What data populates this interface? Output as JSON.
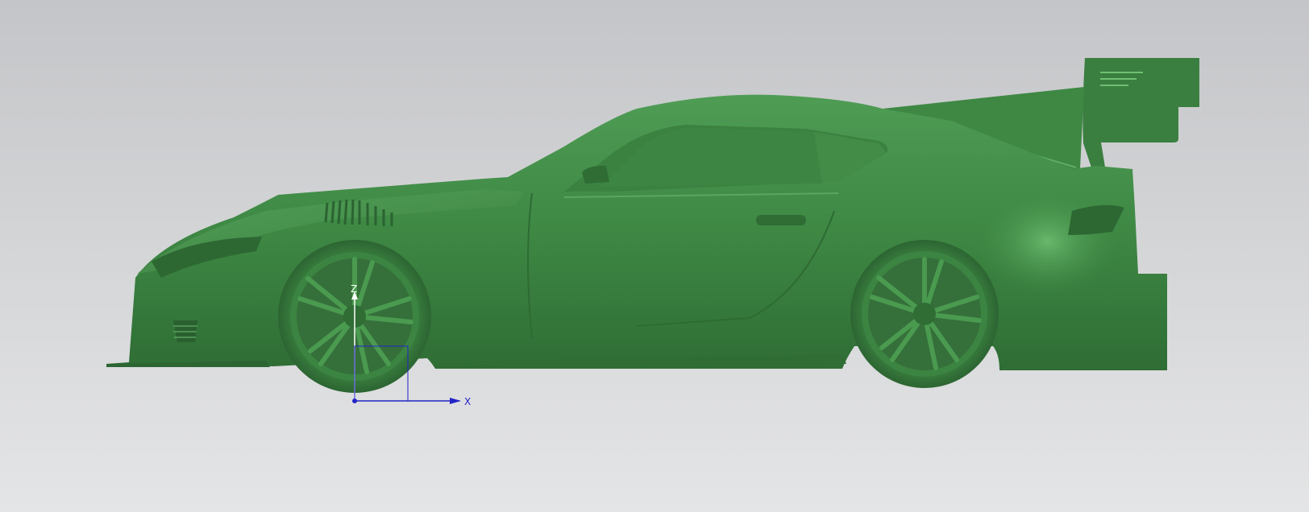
{
  "viewport": {
    "background_top": "#c4c5c8",
    "background_bottom": "#e4e5e6"
  },
  "model": {
    "body_color": "#3f8a45",
    "highlight_color": "#5eae63",
    "shadow_color": "#2f6d35"
  },
  "triad": {
    "z_label": "Z",
    "x_label": "X",
    "axis_color": "#2424c8",
    "z_axis_color": "#ffffff"
  }
}
